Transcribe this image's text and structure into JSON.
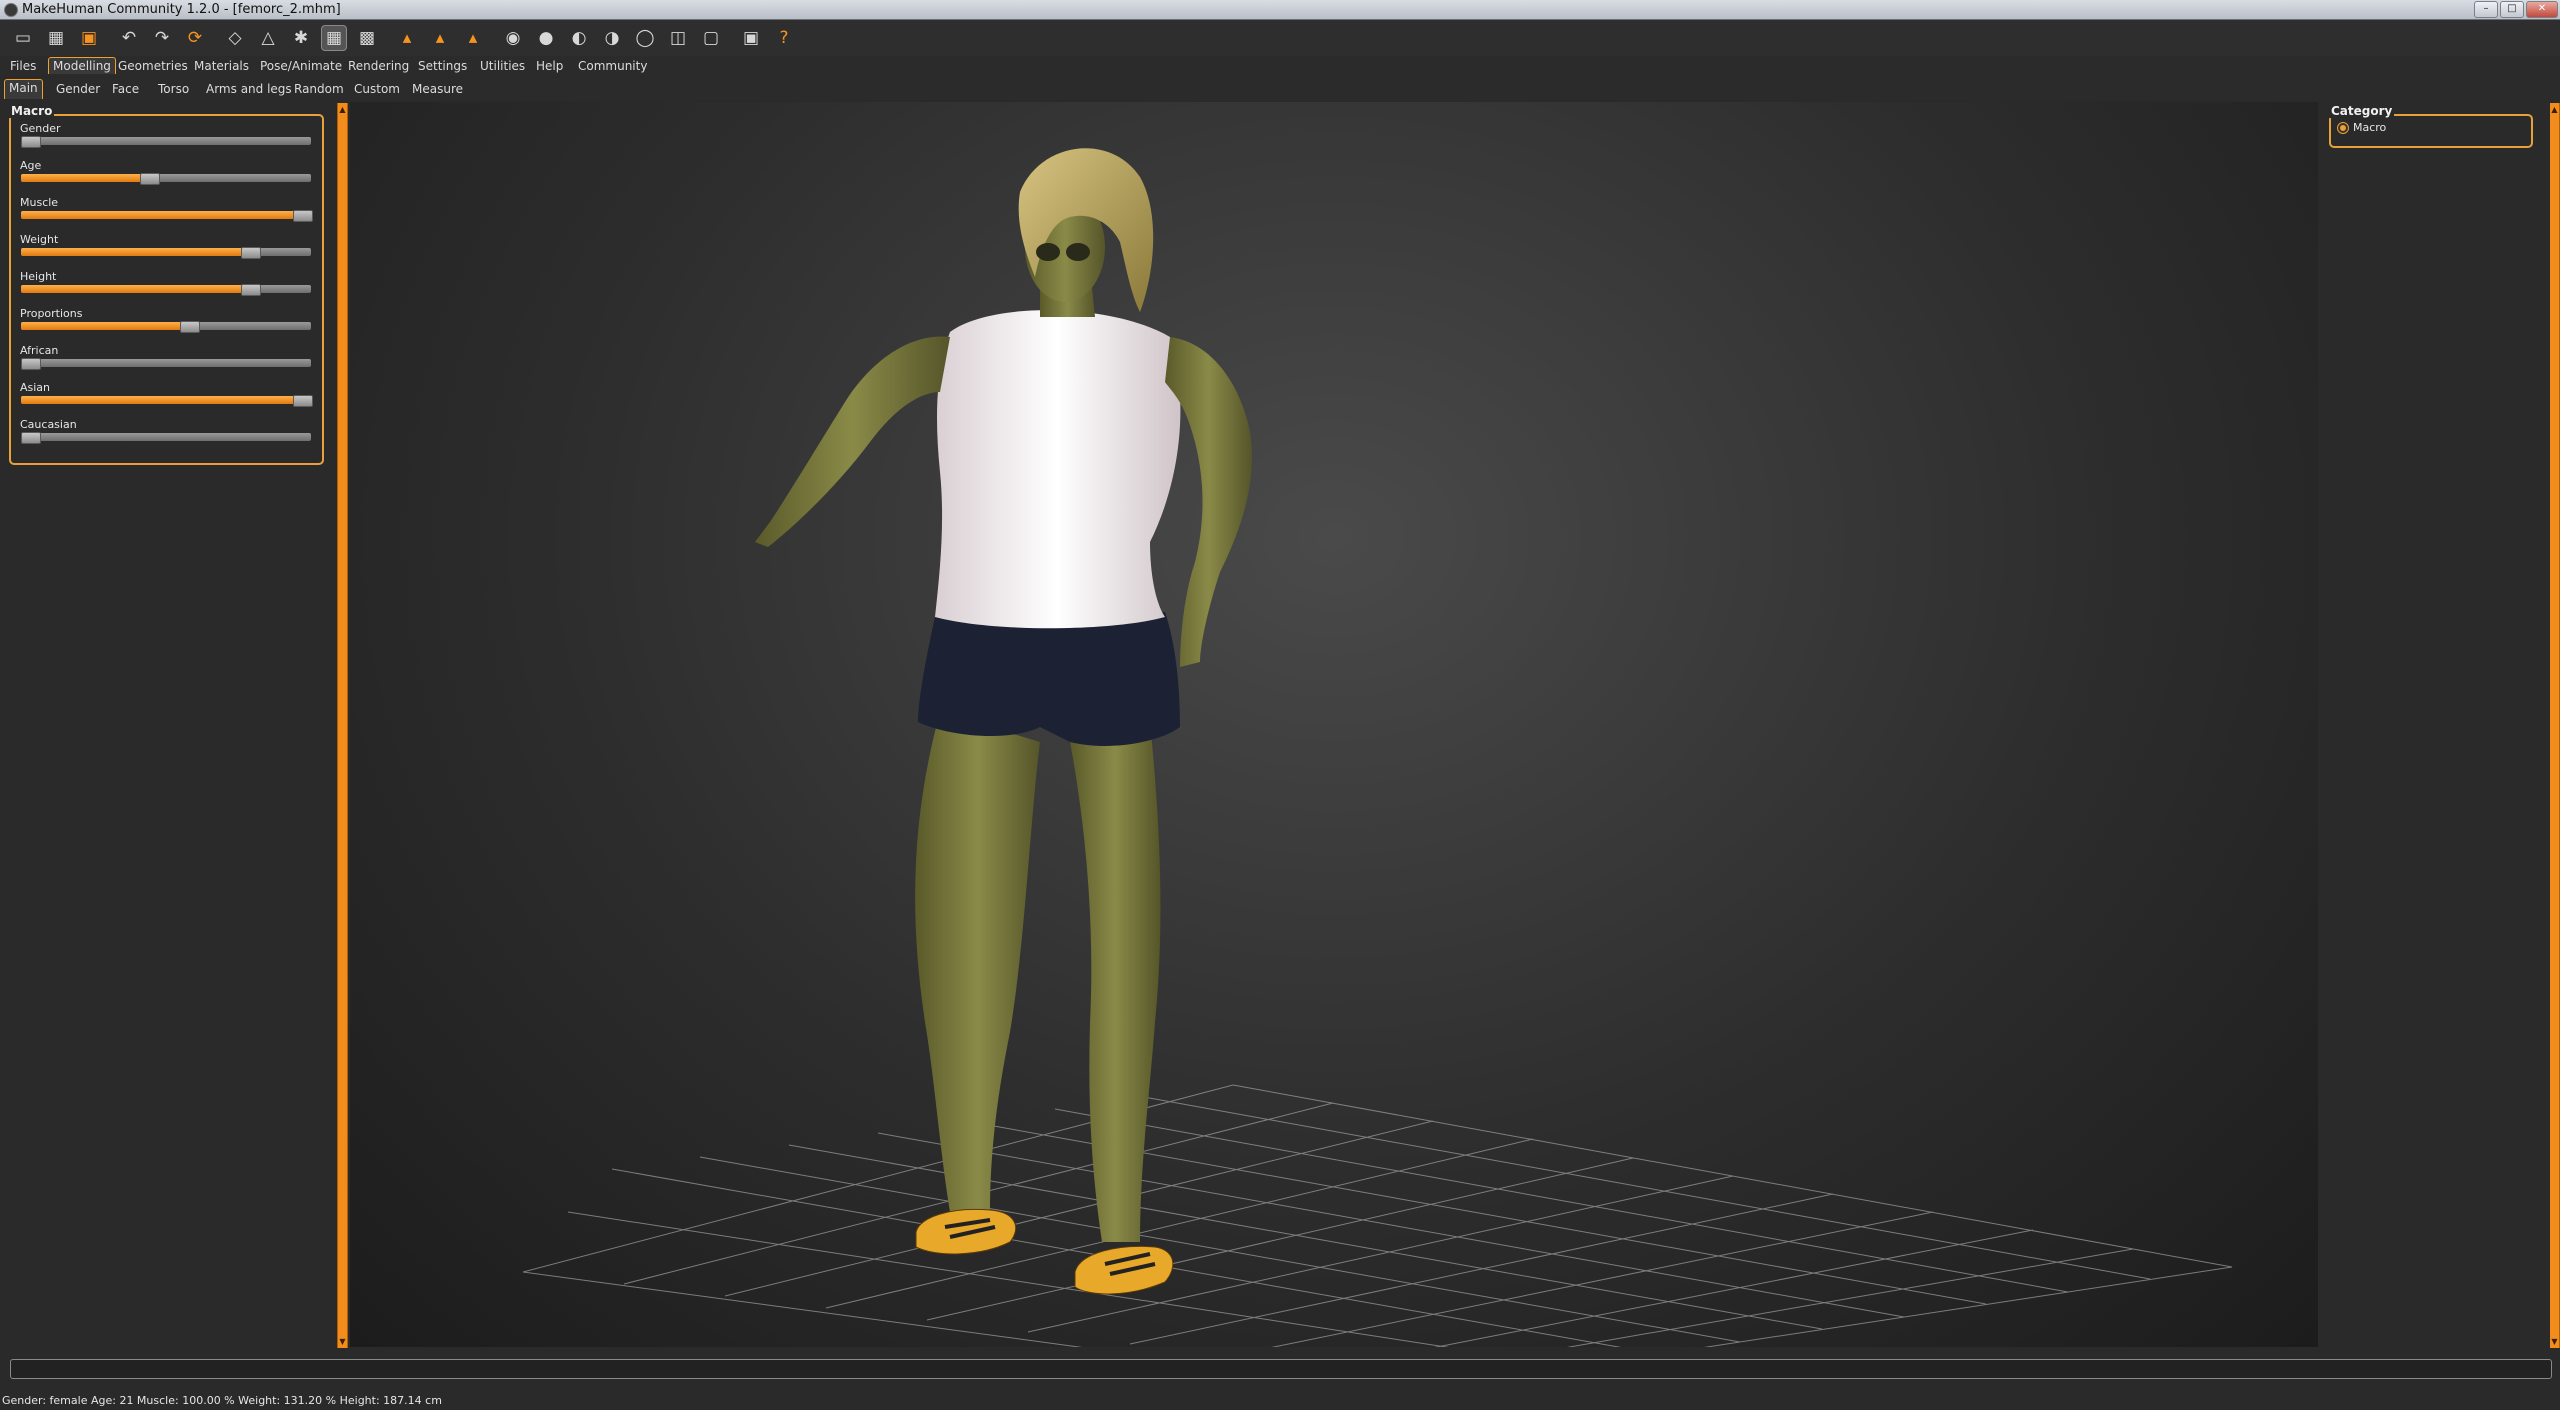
{
  "window": {
    "title": "MakeHuman Community 1.2.0 - [femorc_2.mhm]"
  },
  "toolbar": {
    "icons": [
      "new-icon",
      "save-icon",
      "export-icon",
      "undo-icon",
      "redo-icon",
      "reset-icon",
      "smooth-icon",
      "wireframe-icon",
      "pose-icon",
      "grid-icon",
      "checker-icon",
      "symmetry-right-icon",
      "symmetry-left-icon",
      "symmetry-icon",
      "front-view-icon",
      "back-view-icon",
      "left-view-icon",
      "right-view-icon",
      "top-view-icon",
      "bottom-view-icon",
      "reset-camera-icon",
      "screenshot-icon",
      "help-icon"
    ]
  },
  "main_tabs": [
    "Files",
    "Modelling",
    "Geometries",
    "Materials",
    "Pose/Animate",
    "Rendering",
    "Settings",
    "Utilities",
    "Help",
    "Community"
  ],
  "main_tab_active": "Modelling",
  "sub_tabs": [
    "Main",
    "Gender",
    "Face",
    "Torso",
    "Arms and legs",
    "Random",
    "Custom",
    "Measure"
  ],
  "sub_tab_active": "Main",
  "macro": {
    "title": "Macro",
    "sliders": [
      {
        "label": "Gender",
        "value": 0.0
      },
      {
        "label": "Age",
        "value": 0.44
      },
      {
        "label": "Muscle",
        "value": 1.0
      },
      {
        "label": "Weight",
        "value": 0.79
      },
      {
        "label": "Height",
        "value": 0.79
      },
      {
        "label": "Proportions",
        "value": 0.58
      },
      {
        "label": "African",
        "value": 0.0
      },
      {
        "label": "Asian",
        "value": 1.0
      },
      {
        "label": "Caucasian",
        "value": 0.0
      }
    ]
  },
  "category": {
    "title": "Category",
    "option": "Macro"
  },
  "status": "Gender: female  Age: 21  Muscle: 100.00 %  Weight: 131.20 %  Height: 187.14 cm",
  "colors": {
    "accent": "#f28c1c",
    "background": "#2a2a2a"
  }
}
